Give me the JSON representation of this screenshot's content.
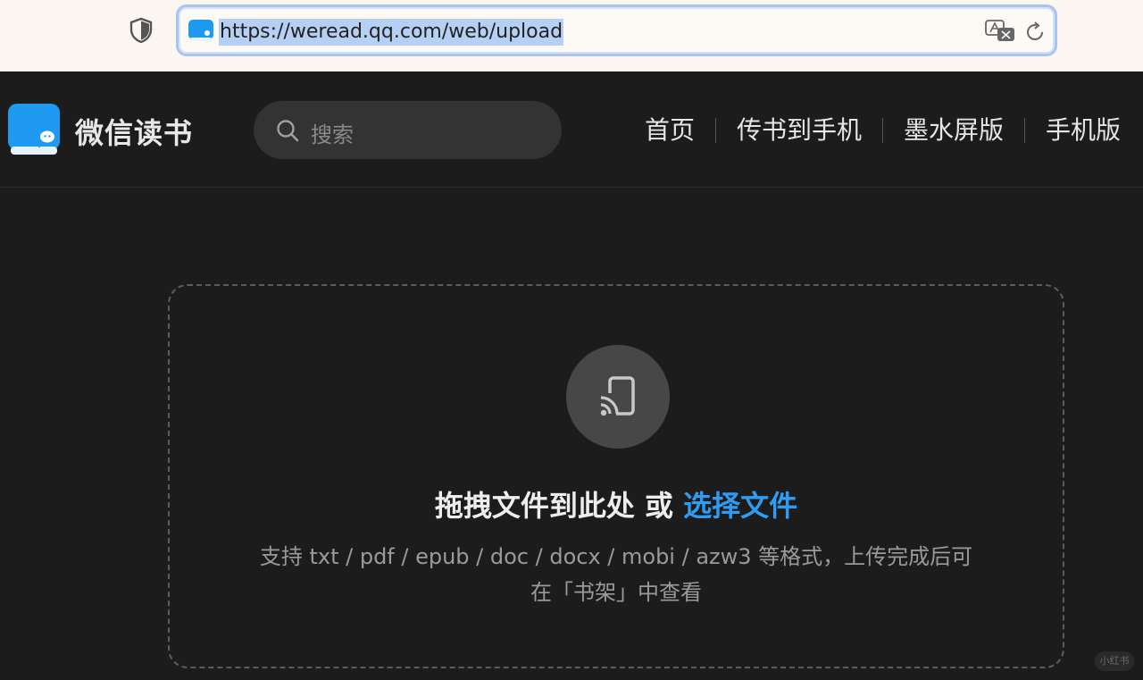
{
  "browser": {
    "url": "https://weread.qq.com/web/upload",
    "icons": [
      "shield-icon",
      "site-favicon",
      "translate-icon",
      "reload-icon"
    ]
  },
  "header": {
    "brand": "微信读书",
    "search_placeholder": "搜索",
    "nav": [
      {
        "label": "首页"
      },
      {
        "label": "传书到手机"
      },
      {
        "label": "墨水屏版"
      },
      {
        "label": "手机版"
      }
    ]
  },
  "upload": {
    "icon": "cast-to-device-icon",
    "drop_text": "拖拽文件到此处",
    "or_text": "或",
    "choose_label": "选择文件",
    "formats_line1": "支持 txt / pdf / epub / doc / docx / mobi / azw3 等格式，上传完成后可",
    "formats_line2": "在「书架」中查看"
  },
  "colors": {
    "page_bg": "#1c1c1c",
    "accent": "#2f9cf4",
    "logo_blue": "#1e9bf0"
  },
  "watermark": "小红书"
}
